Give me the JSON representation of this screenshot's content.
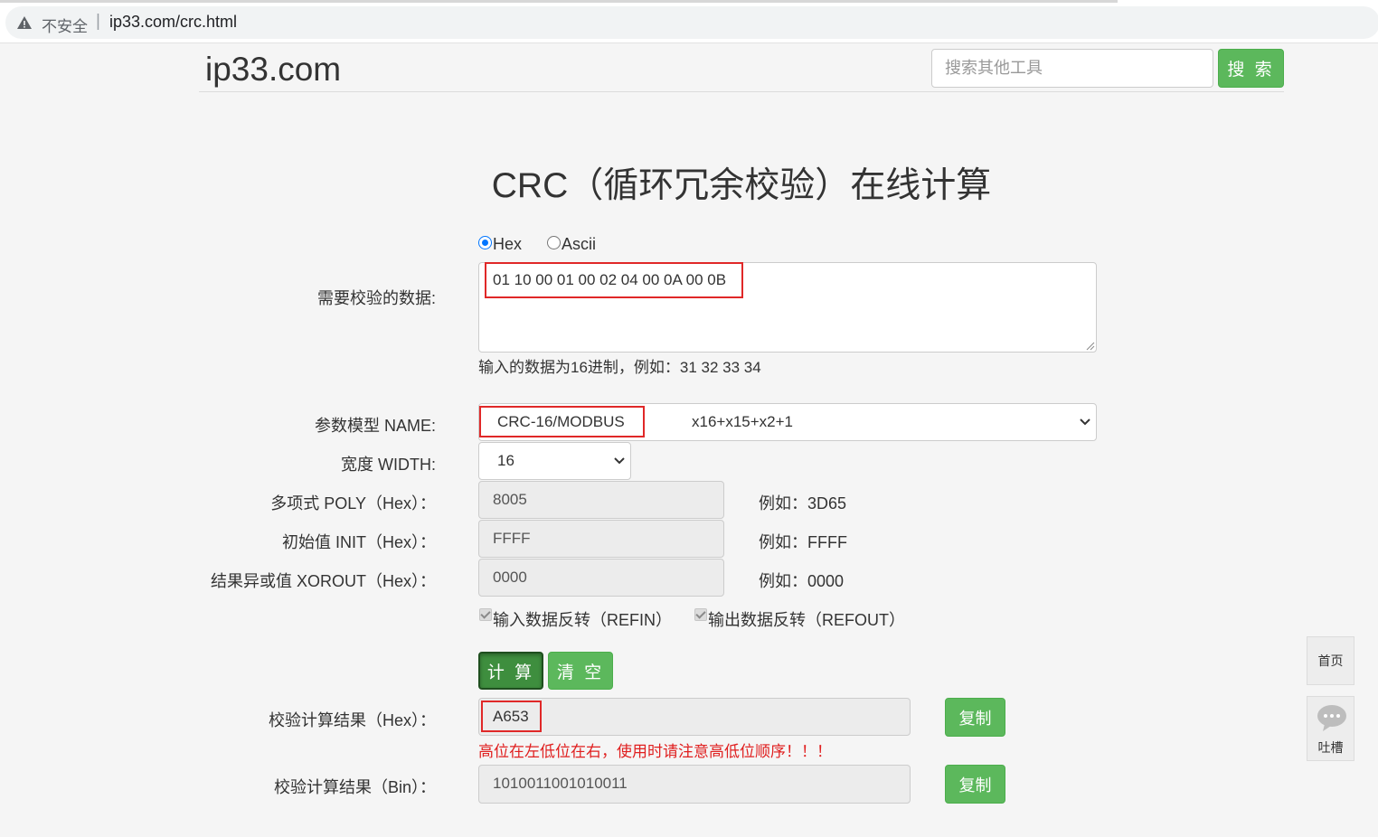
{
  "browser": {
    "security_label": "不安全",
    "separator": "|",
    "url": "ip33.com/crc.html"
  },
  "header": {
    "logo": "ip33.com",
    "search_placeholder": "搜索其他工具",
    "search_button": "搜 索"
  },
  "page": {
    "title": "CRC（循环冗余校验）在线计算"
  },
  "form": {
    "format_options": [
      {
        "label": "Hex",
        "checked": true
      },
      {
        "label": "Ascii",
        "checked": false
      }
    ],
    "data_label": "需要校验的数据:",
    "data_value": "01 10 00 01 00 02 04 00 0A 00 0B",
    "data_hint": "输入的数据为16进制，例如：31 32 33 34",
    "model_label": "参数模型 NAME:",
    "model_name": "CRC-16/MODBUS",
    "model_poly": "x16+x15+x2+1",
    "width_label": "宽度 WIDTH:",
    "width_value": "16",
    "poly_label": "多项式 POLY（Hex）：",
    "poly_value": "8005",
    "poly_example": "例如：3D65",
    "init_label": "初始值 INIT（Hex）：",
    "init_value": "FFFF",
    "init_example": "例如：FFFF",
    "xorout_label": "结果异或值 XOROUT（Hex）：",
    "xorout_value": "0000",
    "xorout_example": "例如：0000",
    "refin_label": "输入数据反转（REFIN）",
    "refout_label": "输出数据反转（REFOUT）",
    "calc_button": "计 算",
    "clear_button": "清 空"
  },
  "result": {
    "hex_label": "校验计算结果（Hex）：",
    "hex_value": "A653",
    "copy_label": "复制",
    "warning": "高位在左低位在右，使用时请注意高低位顺序！！！",
    "bin_label": "校验计算结果（Bin）：",
    "bin_value": "1010011001010011"
  },
  "float_tools": {
    "home": "首页",
    "feedback": "吐槽"
  },
  "colors": {
    "primary_green": "#5cb85c",
    "highlight_red": "#e02828",
    "warning_red": "#e02020"
  }
}
